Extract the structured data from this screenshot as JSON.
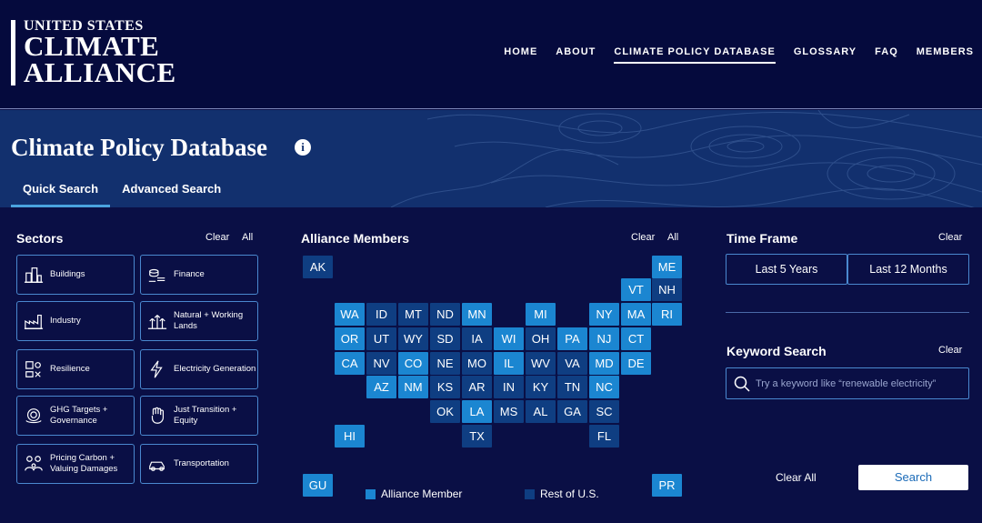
{
  "logo": {
    "line1": "UNITED STATES",
    "line2": "CLIMATE",
    "line3": "ALLIANCE"
  },
  "nav": [
    "HOME",
    "ABOUT",
    "CLIMATE POLICY DATABASE",
    "GLOSSARY",
    "FAQ",
    "MEMBERS"
  ],
  "nav_active": "CLIMATE POLICY DATABASE",
  "hero": {
    "title": "Climate Policy Database",
    "info": "i"
  },
  "tabs": [
    "Quick Search",
    "Advanced Search"
  ],
  "sectors": {
    "title": "Sectors",
    "clear": "Clear",
    "all": "All",
    "items": [
      {
        "label": "Buildings",
        "icon": "buildings-icon"
      },
      {
        "label": "Finance",
        "icon": "finance-icon"
      },
      {
        "label": "Industry",
        "icon": "industry-icon"
      },
      {
        "label": "Natural + Working Lands",
        "icon": "natural-lands-icon"
      },
      {
        "label": "Resilience",
        "icon": "resilience-icon"
      },
      {
        "label": "Electricity Generation",
        "icon": "lightning-icon"
      },
      {
        "label": "GHG Targets + Governance",
        "icon": "ghg-targets-icon"
      },
      {
        "label": "Just Transition + Equity",
        "icon": "fist-icon"
      },
      {
        "label": "Pricing Carbon + Valuing Damages",
        "icon": "pricing-carbon-icon"
      },
      {
        "label": "Transportation",
        "icon": "car-icon"
      }
    ]
  },
  "members": {
    "title": "Alliance Members",
    "clear": "Clear",
    "all": "All",
    "legend_member": "Alliance Member",
    "legend_rest": "Rest of U.S.",
    "states": [
      {
        "code": "AK",
        "member": false
      },
      {
        "code": "ME",
        "member": true
      },
      {
        "code": "VT",
        "member": true
      },
      {
        "code": "NH",
        "member": false
      },
      {
        "code": "WA",
        "member": true
      },
      {
        "code": "ID",
        "member": false
      },
      {
        "code": "MT",
        "member": false
      },
      {
        "code": "ND",
        "member": false
      },
      {
        "code": "MN",
        "member": true
      },
      {
        "code": "MI",
        "member": true
      },
      {
        "code": "NY",
        "member": true
      },
      {
        "code": "MA",
        "member": true
      },
      {
        "code": "RI",
        "member": true
      },
      {
        "code": "OR",
        "member": true
      },
      {
        "code": "UT",
        "member": false
      },
      {
        "code": "WY",
        "member": false
      },
      {
        "code": "SD",
        "member": false
      },
      {
        "code": "IA",
        "member": false
      },
      {
        "code": "WI",
        "member": true
      },
      {
        "code": "OH",
        "member": false
      },
      {
        "code": "PA",
        "member": true
      },
      {
        "code": "NJ",
        "member": true
      },
      {
        "code": "CT",
        "member": true
      },
      {
        "code": "CA",
        "member": true
      },
      {
        "code": "NV",
        "member": false
      },
      {
        "code": "CO",
        "member": true
      },
      {
        "code": "NE",
        "member": false
      },
      {
        "code": "MO",
        "member": false
      },
      {
        "code": "IL",
        "member": true
      },
      {
        "code": "WV",
        "member": false
      },
      {
        "code": "VA",
        "member": false
      },
      {
        "code": "MD",
        "member": true
      },
      {
        "code": "DE",
        "member": true
      },
      {
        "code": "AZ",
        "member": true
      },
      {
        "code": "NM",
        "member": true
      },
      {
        "code": "KS",
        "member": false
      },
      {
        "code": "AR",
        "member": false
      },
      {
        "code": "IN",
        "member": false
      },
      {
        "code": "KY",
        "member": false
      },
      {
        "code": "TN",
        "member": false
      },
      {
        "code": "NC",
        "member": true
      },
      {
        "code": "OK",
        "member": false
      },
      {
        "code": "LA",
        "member": true
      },
      {
        "code": "MS",
        "member": false
      },
      {
        "code": "AL",
        "member": false
      },
      {
        "code": "GA",
        "member": false
      },
      {
        "code": "SC",
        "member": false
      },
      {
        "code": "HI",
        "member": true
      },
      {
        "code": "TX",
        "member": false
      },
      {
        "code": "FL",
        "member": false
      },
      {
        "code": "GU",
        "member": true
      },
      {
        "code": "PR",
        "member": true
      }
    ]
  },
  "timeframe": {
    "title": "Time Frame",
    "clear": "Clear",
    "options": [
      "Last 5 Years",
      "Last 12 Months"
    ]
  },
  "keyword": {
    "title": "Keyword Search",
    "clear": "Clear",
    "placeholder": "Try a keyword like “renewable electricity”"
  },
  "actions": {
    "clear_all": "Clear All",
    "search": "Search"
  },
  "colors": {
    "header_bg": "#050a3d",
    "page_bg": "#0a0f45",
    "hero_bg": "#12306e",
    "member": "#1b86d1",
    "rest": "#0f3e82",
    "border": "#4a88cf"
  }
}
